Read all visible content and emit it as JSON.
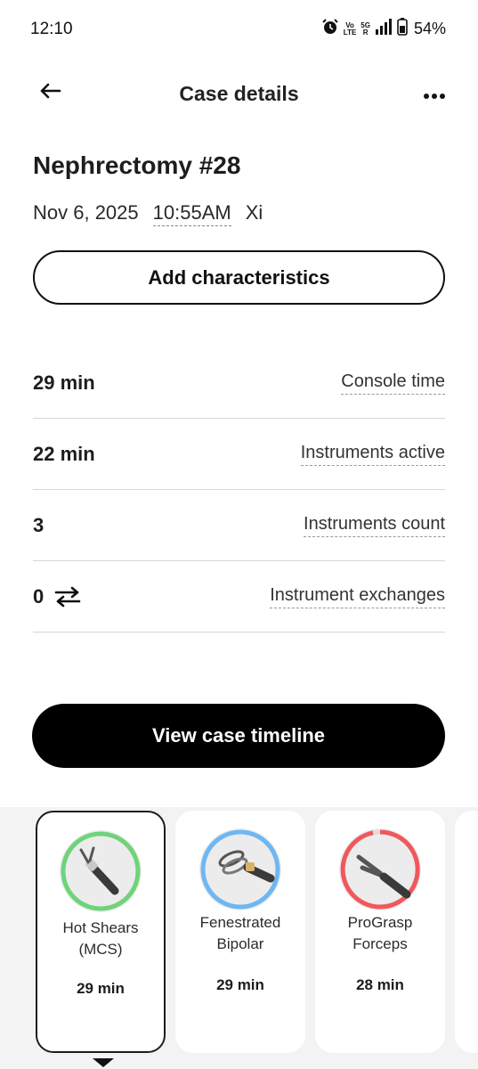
{
  "status_bar": {
    "time": "12:10",
    "battery_pct": "54%",
    "net_volte_top": "Vo",
    "net_volte_bottom": "LTE",
    "net_5g": "5G",
    "net_r": "R"
  },
  "header": {
    "title": "Case details"
  },
  "case": {
    "name": "Nephrectomy #28",
    "date": "Nov 6, 2025",
    "time": "10:55AM",
    "system": "Xi"
  },
  "actions": {
    "add_characteristics": "Add characteristics",
    "view_timeline": "View case timeline"
  },
  "metrics": [
    {
      "value": "29 min",
      "label": "Console time"
    },
    {
      "value": "22 min",
      "label": "Instruments active"
    },
    {
      "value": "3",
      "label": "Instruments count"
    },
    {
      "value": "0",
      "label": "Instrument exchanges"
    }
  ],
  "instruments": [
    {
      "name_line1": "Hot Shears",
      "name_line2": "(MCS)",
      "duration": "29 min",
      "ring_color": "#6fd37a",
      "icon": "hot-shears-icon"
    },
    {
      "name_line1": "Fenestrated",
      "name_line2": "Bipolar",
      "duration": "29 min",
      "ring_color": "#6eb7f2",
      "icon": "fenestrated-bipolar-icon"
    },
    {
      "name_line1": "ProGrasp",
      "name_line2": "Forceps",
      "duration": "28 min",
      "ring_color": "#f0585c",
      "icon": "prograsp-forceps-icon"
    }
  ],
  "colors": {
    "primary_button": "#000000",
    "ring_track": "#dddddd"
  }
}
